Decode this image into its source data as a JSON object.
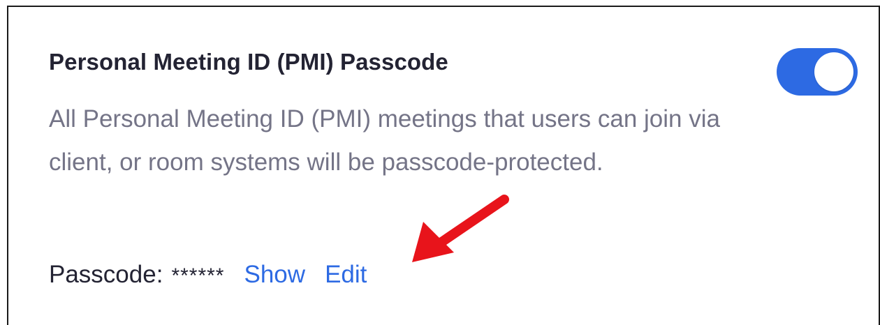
{
  "setting": {
    "title": "Personal Meeting ID (PMI) Passcode",
    "description": "All Personal Meeting ID (PMI) meetings that users can join via client, or room systems will be passcode-protected.",
    "enabled": true
  },
  "passcode": {
    "label": "Passcode:",
    "masked_value": "******",
    "show_label": "Show",
    "edit_label": "Edit"
  },
  "annotation": {
    "icon": "red-arrow-icon",
    "color": "#e8141b"
  },
  "colors": {
    "accent": "#2d6ae3",
    "title": "#232333",
    "description": "#747487"
  }
}
